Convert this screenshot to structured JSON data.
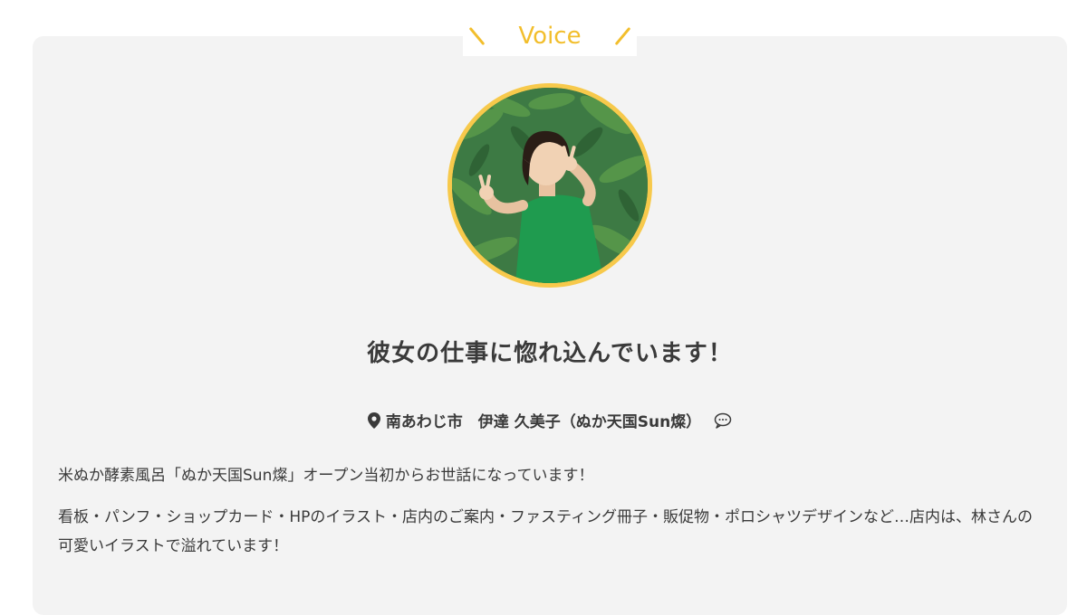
{
  "section": {
    "heading": "Voice",
    "accent_color": "#f2be2c"
  },
  "testimonial": {
    "avatar_icon": "person-photo",
    "title": "彼女の仕事に惚れ込んでいます！",
    "meta": {
      "location_icon": "map-pin-icon",
      "text": "南あわじ市　伊達 久美子（ぬか天国Sun燦）",
      "comment_icon": "speech-bubble-icon"
    },
    "paragraphs": [
      "米ぬか酵素風呂「ぬか天国Sun燦」オープン当初からお世話になっています！",
      "看板・パンフ・ショップカード・HPのイラスト・店内のご案内・ファスティング冊子・販促物・ポロシャツデザインなど…店内は、林さんの可愛いイラストで溢れています！"
    ]
  }
}
